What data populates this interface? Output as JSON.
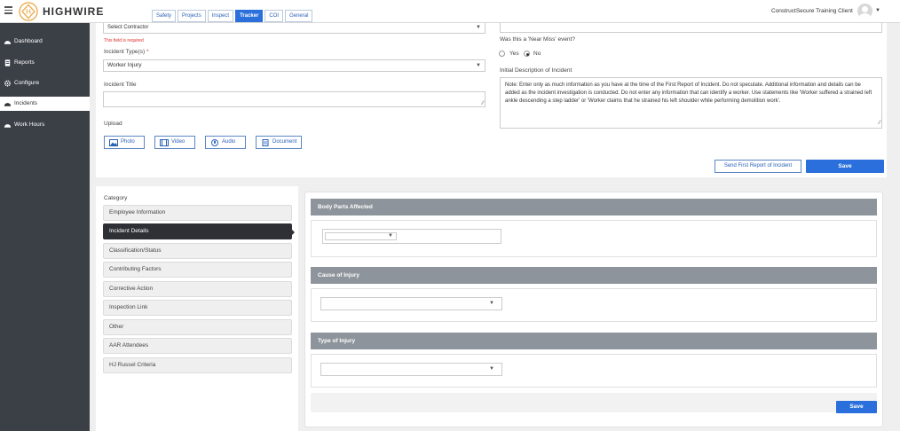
{
  "header": {
    "app_name": "HIGHWIRE",
    "tabs": [
      {
        "label": "Safety"
      },
      {
        "label": "Projects"
      },
      {
        "label": "Inspect"
      },
      {
        "label": "Tracker"
      },
      {
        "label": "COI"
      },
      {
        "label": "General"
      }
    ],
    "active_tab": "Tracker",
    "client_name": "ConstructSecure Training Client"
  },
  "sidebar": {
    "items": [
      {
        "label": "Dashboard",
        "icon": "dashboard-icon"
      },
      {
        "label": "Reports",
        "icon": "reports-icon"
      },
      {
        "label": "Configure",
        "icon": "gear-icon"
      },
      {
        "label": "Incidents",
        "icon": "incidents-icon"
      },
      {
        "label": "Work Hours",
        "icon": "work-hours-icon"
      }
    ],
    "active": "Incidents"
  },
  "form": {
    "contractor_value": "Select Contractor",
    "required_msg": "This field is required",
    "incident_type_label": "Incident Type(s)",
    "incident_type_value": "Worker Injury",
    "incident_title_label": "Incident Title",
    "incident_title_value": "",
    "upload_label": "Upload",
    "upload_buttons": [
      {
        "label": "Photo",
        "icon": "photo-icon"
      },
      {
        "label": "Video",
        "icon": "video-icon"
      },
      {
        "label": "Audio",
        "icon": "audio-icon"
      },
      {
        "label": "Document",
        "icon": "document-icon"
      }
    ],
    "near_miss_label": "Was this a 'Near Miss' event?",
    "near_miss_options": [
      "Yes",
      "No"
    ],
    "near_miss_selected": "No",
    "initial_desc_label": "Initial Description of Incident",
    "initial_desc_text": "Note: Enter only as much information as you have at the time of the First Report of Incident. Do not speculate. Additional information and details can be added as the incident investigation is conducted.  Do not enter any information that can identify a worker.  Use statements like 'Worker suffered a strained left ankle descending a step ladder' or 'Worker claims that he strained his left shoulder while performing demolition work'.",
    "send_report_label": "Send First Report of Incident",
    "save_label": "Save"
  },
  "category": {
    "label": "Category",
    "items": [
      "Employee Information",
      "Incident Details",
      "Classification/Status",
      "Contributing Factors",
      "Corrective Action",
      "Inspection Link",
      "Other",
      "AAR Attendees",
      "HJ Russel Criteria"
    ],
    "active": "Incident Details"
  },
  "details": {
    "sections": [
      {
        "title": "Body Parts Affected"
      },
      {
        "title": "Cause of Injury"
      },
      {
        "title": "Type of Injury"
      }
    ],
    "save_label": "Save"
  },
  "colors": {
    "primary": "#2a6fdb",
    "sidebar_bg": "#3b4047",
    "section_header": "#8e949b",
    "required": "#d9302c",
    "logo_accent": "#e8a23a"
  }
}
